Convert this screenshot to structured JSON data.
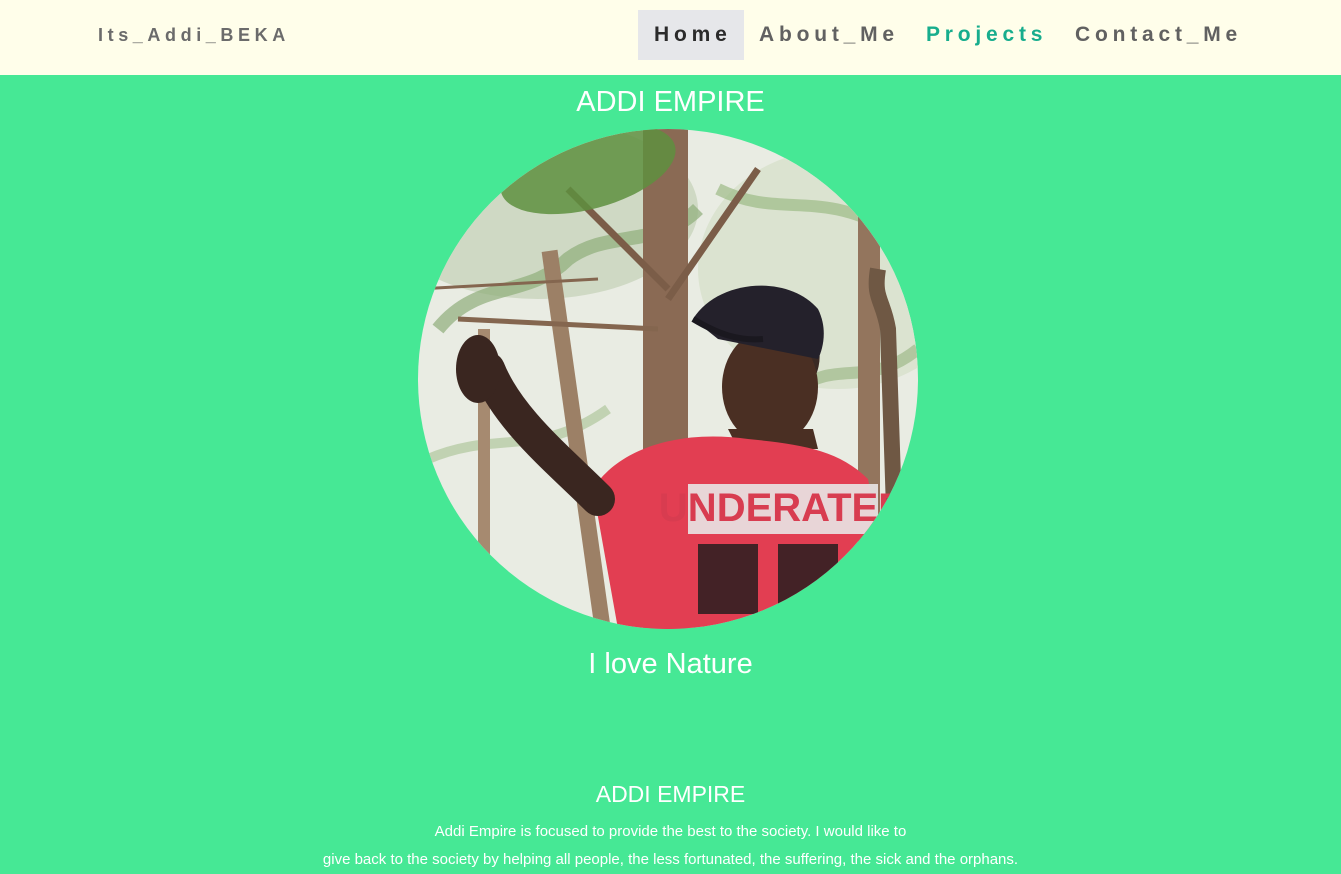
{
  "nav": {
    "brand": "Its_Addi_BEKA",
    "links": [
      {
        "label": "Home",
        "active": true
      },
      {
        "label": "About_Me",
        "active": false
      },
      {
        "label": "Projects",
        "active": false
      },
      {
        "label": "Contact_Me",
        "active": false
      }
    ]
  },
  "hero": {
    "title": "ADDI EMPIRE",
    "portrait_shirt_text": "UNDERATED",
    "tagline": "I love Nature"
  },
  "about": {
    "title": "ADDI EMPIRE",
    "lines": [
      "Addi Empire is focused to provide the best to the society. I would like to",
      "give back to the society by helping all people, the less fortunated, the suffering, the sick and the orphans."
    ]
  },
  "colors": {
    "background": "#46e895",
    "navbar": "#fffeea",
    "active_nav_bg": "#e6e7ea",
    "projects_link": "#17ad8d",
    "text": "#ffffff"
  }
}
